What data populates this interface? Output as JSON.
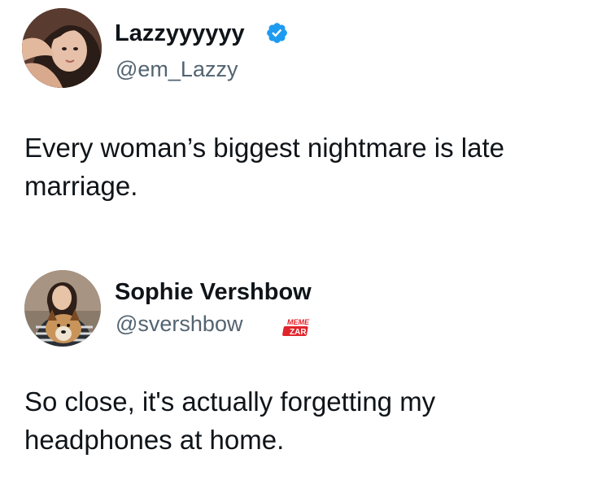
{
  "tweets": [
    {
      "display_name": "Lazzyyyyyy",
      "handle": "@em_Lazzy",
      "verified": true,
      "text": "Every woman’s biggest nightmare is late marriage."
    },
    {
      "display_name": "Sophie Vershbow",
      "handle": "@svershbow",
      "verified": false,
      "text": "So close, it's actually forgetting my headphones at home."
    }
  ],
  "watermark": {
    "line1": "MEME",
    "line2": "ZAR"
  },
  "colors": {
    "text": "#0f1419",
    "secondary_text": "#536471",
    "verified_badge": "#1d9bf0",
    "watermark_red": "#e0242b"
  }
}
